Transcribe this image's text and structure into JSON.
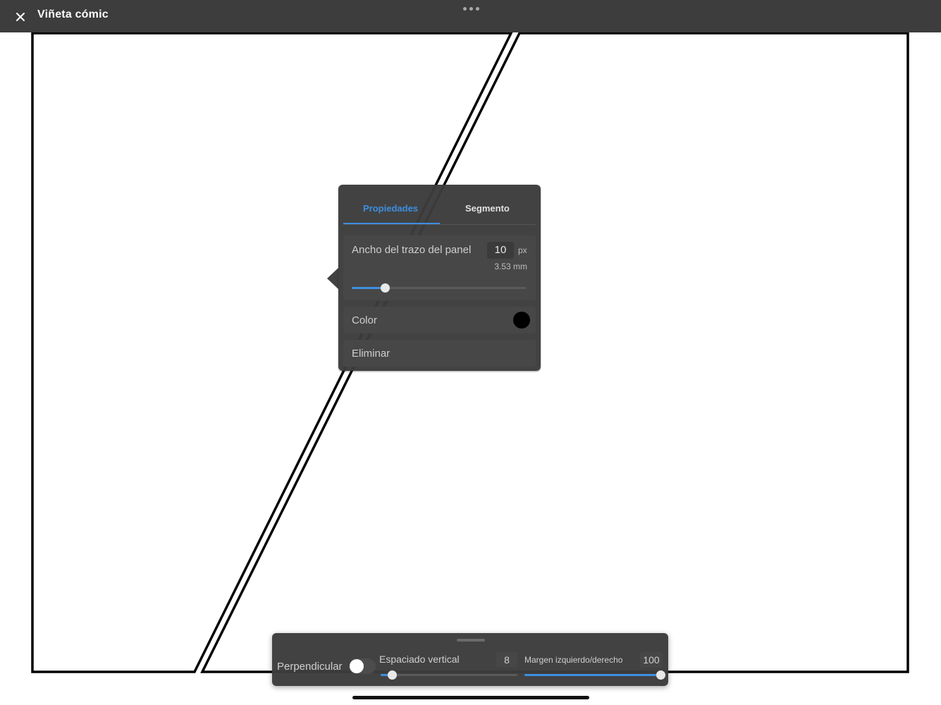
{
  "app": {
    "title": "Viñeta cómic",
    "close_icon": "close-icon",
    "more_icon": "ellipsis-icon"
  },
  "popover": {
    "tabs": [
      {
        "label": "Propiedades",
        "active": true
      },
      {
        "label": "Segmento",
        "active": false
      }
    ],
    "stroke_width": {
      "label": "Ancho del trazo del panel",
      "value": "10",
      "unit": "px",
      "mm": "3.53 mm",
      "slider_fraction": 0.19
    },
    "color": {
      "label": "Color",
      "value": "#000000"
    },
    "delete_label": "Eliminar"
  },
  "toolbar": {
    "perpendicular_label": "Perpendicular",
    "perpendicular_on": false,
    "vertical_spacing": {
      "label": "Espaciado vertical",
      "value": "8",
      "slider_fraction": 0.08
    },
    "side_margin": {
      "label": "Margen izquierdo/derecho",
      "value": "100",
      "slider_fraction": 1.0
    }
  },
  "colors": {
    "accent": "#3d8fe0",
    "panel_bg": "#3c3c3c",
    "topbar_bg": "#3d3d3d"
  }
}
